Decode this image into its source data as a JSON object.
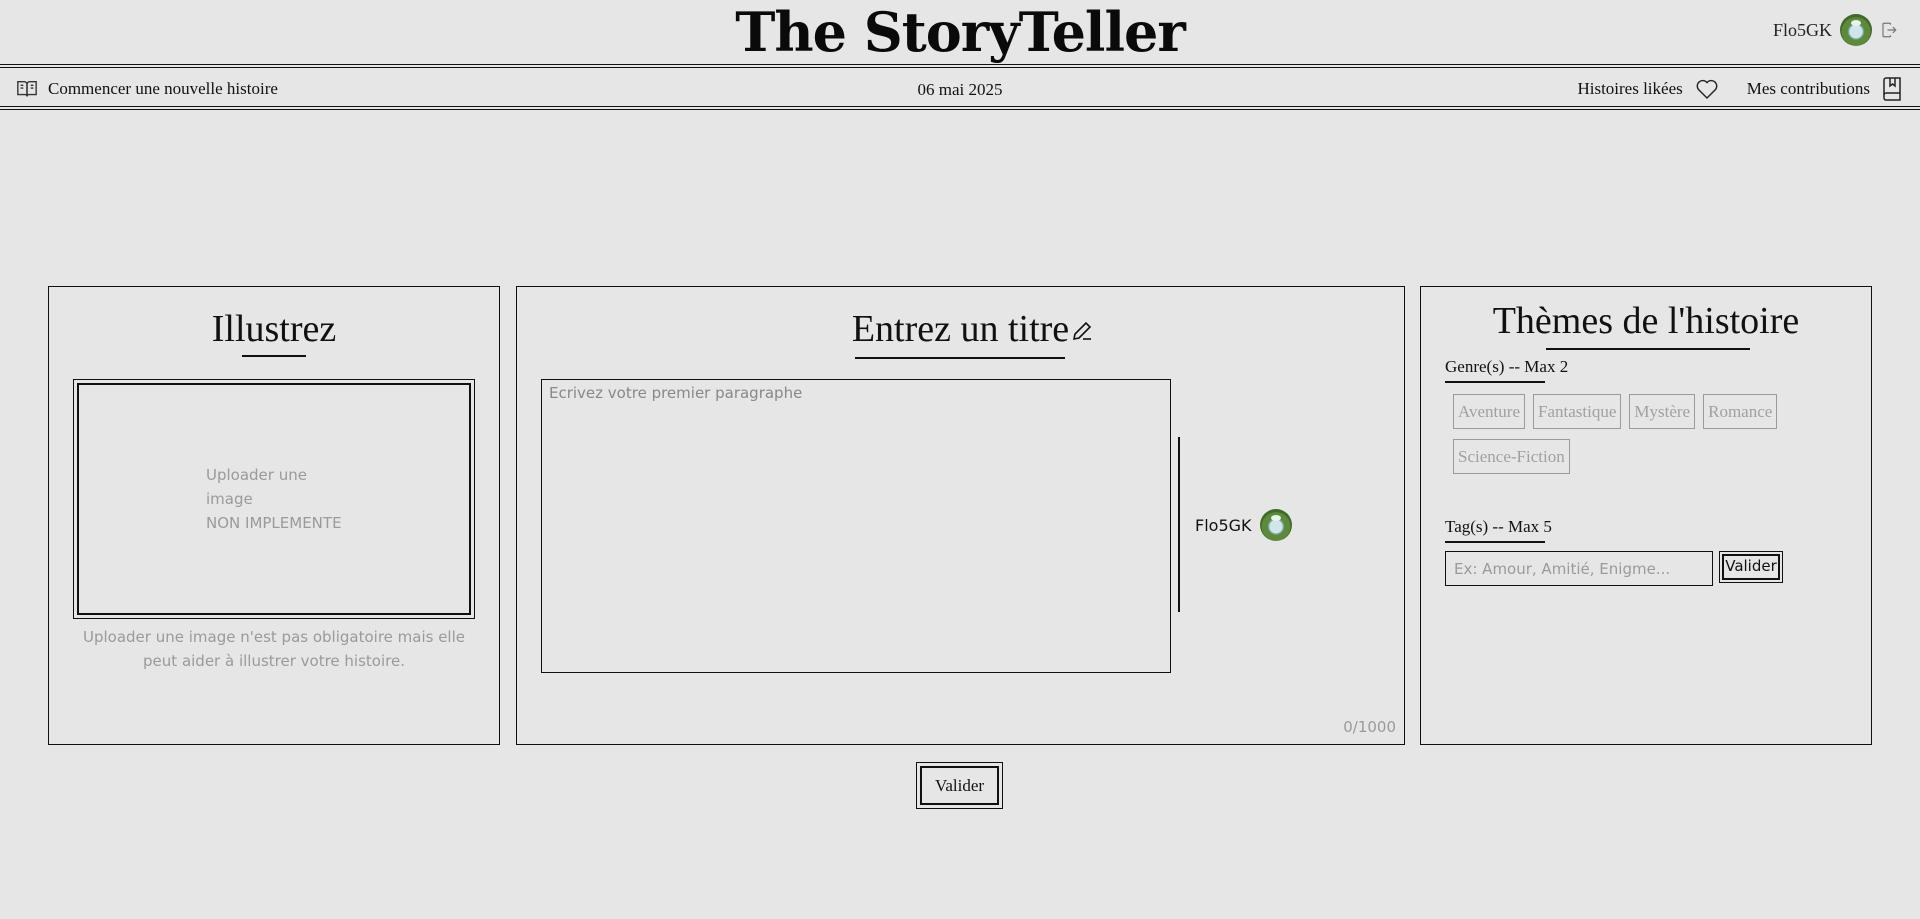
{
  "header": {
    "brand": "The StoryTeller",
    "user_name": "Flo5GK",
    "avatar_icon": "avatar-icon",
    "logout_icon": "logout-icon"
  },
  "toolbar": {
    "new_story_label": "Commencer une nouvelle histoire",
    "new_story_icon": "open-book-icon",
    "date": "06 mai 2025",
    "liked_label": "Histoires likées",
    "liked_icon": "heart-icon",
    "contributions_label": "Mes contributions",
    "contributions_icon": "bookmark-book-icon"
  },
  "illustration": {
    "title": "Illustrez",
    "upload_line1": "Uploader une image",
    "upload_line2": "NON IMPLEMENTE",
    "help_text": "Uploader une image n'est pas obligatoire mais elle peut aider à illustrer votre histoire."
  },
  "editor": {
    "title": "Entrez un titre",
    "title_icon": "pencil-icon",
    "paragraph_placeholder": "Ecrivez votre premier paragraphe",
    "paragraph_value": "",
    "author_name": "Flo5GK",
    "char_counter": "0/1000"
  },
  "themes": {
    "title": "Thèmes de l'histoire",
    "genre_label": "Genre(s) -- Max 2",
    "genres": [
      "Aventure",
      "Fantastique",
      "Mystère",
      "Romance",
      "Science-Fiction"
    ],
    "tag_label": "Tag(s) -- Max 5",
    "tag_placeholder": "Ex: Amour, Amitié, Enigme...",
    "tag_value": "",
    "tag_button": "Valider"
  },
  "actions": {
    "submit_label": "Valider"
  },
  "colors": {
    "background": "#e6e6e6",
    "ink": "#111111",
    "muted": "#9a9a9a"
  }
}
